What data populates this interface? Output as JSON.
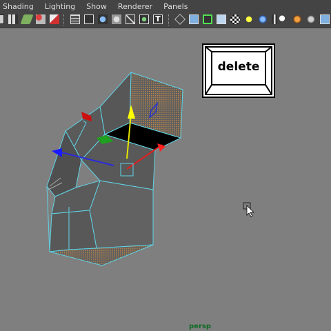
{
  "menubar": {
    "items": [
      "Shading",
      "Lighting",
      "Show",
      "Renderer",
      "Panels"
    ]
  },
  "toolbar": {
    "icons": [
      "camera-select-icon",
      "camera-attributes-icon",
      "bookmarks-icon",
      "image-plane-icon",
      "two-d-pan-zoom-icon",
      "grid-icon",
      "film-gate-icon",
      "resolution-gate-icon",
      "field-chart-icon",
      "safe-action-icon",
      "wireframe-icon",
      "smooth-shade-icon",
      "flat-shade-icon",
      "bounding-box-icon",
      "textured-icon",
      "use-all-lights-icon",
      "shadows-icon",
      "isolate-select-icon",
      "xray-icon",
      "xray-joints-icon",
      "xray-active-components-icon",
      "screen-space-ao-icon",
      "motion-blur-icon",
      "multisample-aa-icon",
      "depth-of-field-icon",
      "stereo-icon"
    ],
    "text_icon_glyph": "T"
  },
  "viewport": {
    "camera": "persp",
    "background": "#7f7f7f",
    "wire_color": "#5fd4e6"
  },
  "overlay": {
    "delete_key_label": "delete"
  }
}
